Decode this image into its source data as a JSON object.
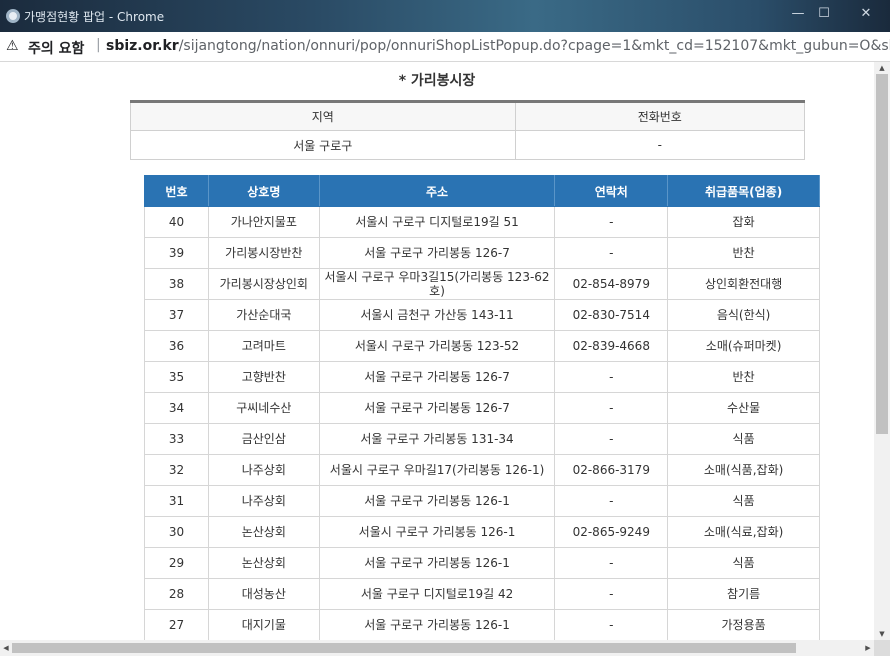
{
  "window": {
    "title": "가맹점현황 팝업 - Chrome",
    "minimize_glyph": "—",
    "maximize_glyph": "☐",
    "close_glyph": "✕"
  },
  "addressbar": {
    "warning_icon": "⚠",
    "warning_label": "주의 요함",
    "separator": "|",
    "url_domain": "sbiz.or.kr",
    "url_path": "/sijangtong/nation/onnuri/pop/onnuriShopListPopup.do?cpage=1&mkt_cd=152107&mkt_gubun=O&shop_tab..."
  },
  "page": {
    "title": "* 가리봉시장"
  },
  "info_table": {
    "headers": [
      "지역",
      "전화번호"
    ],
    "row": [
      "서울 구로구",
      "-"
    ]
  },
  "shop_table": {
    "headers": [
      "번호",
      "상호명",
      "주소",
      "연락처",
      "취급품목(업종)"
    ],
    "rows": [
      [
        "40",
        "가나안지물포",
        "서울시 구로구 디지털로19길 51",
        "-",
        "잡화"
      ],
      [
        "39",
        "가리봉시장반찬",
        "서울 구로구 가리봉동 126-7",
        "-",
        "반찬"
      ],
      [
        "38",
        "가리봉시장상인회",
        "서울시 구로구 우마3길15(가리봉동 123-62호)",
        "02-854-8979",
        "상인회환전대행"
      ],
      [
        "37",
        "가산순대국",
        "서울시 금천구 가산동 143-11",
        "02-830-7514",
        "음식(한식)"
      ],
      [
        "36",
        "고려마트",
        "서울시 구로구 가리봉동 123-52",
        "02-839-4668",
        "소매(슈퍼마켓)"
      ],
      [
        "35",
        "고향반찬",
        "서울 구로구 가리봉동 126-7",
        "-",
        "반찬"
      ],
      [
        "34",
        "구씨네수산",
        "서울 구로구 가리봉동 126-7",
        "-",
        "수산물"
      ],
      [
        "33",
        "금산인삼",
        "서울 구로구 가리봉동 131-34",
        "-",
        "식품"
      ],
      [
        "32",
        "나주상회",
        "서울시 구로구 우마길17(가리봉동 126-1)",
        "02-866-3179",
        "소매(식품,잡화)"
      ],
      [
        "31",
        "나주상회",
        "서울 구로구 가리봉동 126-1",
        "-",
        "식품"
      ],
      [
        "30",
        "논산상회",
        "서울시 구로구 가리봉동 126-1",
        "02-865-9249",
        "소매(식료,잡화)"
      ],
      [
        "29",
        "논산상회",
        "서울 구로구 가리봉동 126-1",
        "-",
        "식품"
      ],
      [
        "28",
        "대성농산",
        "서울 구로구 디지털로19길 42",
        "-",
        "참기름"
      ],
      [
        "27",
        "대지기물",
        "서울 구로구 가리봉동 126-1",
        "-",
        "가정용품"
      ]
    ]
  },
  "scrollbars": {
    "up_glyph": "▲",
    "down_glyph": "▼",
    "left_glyph": "◀",
    "right_glyph": "▶"
  }
}
